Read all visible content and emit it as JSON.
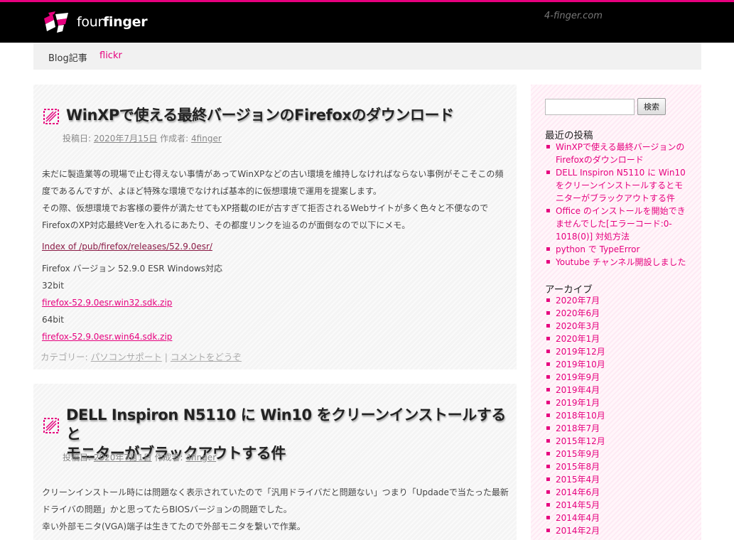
{
  "site": {
    "title_thin": "four",
    "title_bold": "finger",
    "url": "4-finger.com"
  },
  "nav": {
    "items": [
      {
        "label": "Blog記事"
      },
      {
        "label": "flickr"
      }
    ]
  },
  "posts": [
    {
      "title": "WinXPで使える最終バージョンのFirefoxのダウンロード",
      "meta_prefix": "投稿日:",
      "date": "2020年7月15日",
      "author_prefix": "作成者:",
      "author": "4finger",
      "body": [
        "未だに製造業等の現場で止む得えない事情があってWinXPなどの古い環境を維持しなければならない事例がそこそこの頻",
        "度であるんですが、よほど特殊な環境でなければ基本的に仮想環境で運用を提案します。",
        "その際、仮想環境でお客様の要件が満たせてもXP搭載のIEが古すぎて拒否されるWebサイトが多く色々と不便なので",
        "FirefoxのXP対応最終Verを入れるにあたり、その都度リンクを辿るのが面倒なので以下にメモ。"
      ],
      "link_index": "Index of /pub/firefox/releases/52.9.0esr/",
      "version_line": "Firefox バージョン 52.9.0 ESR Windows対応",
      "bit32": "32bit",
      "link32": "firefox-52.9.0esr.win32.sdk.zip",
      "bit64": "64bit",
      "link64": "firefox-52.9.0esr.win64.sdk.zip",
      "cat_prefix": "カテゴリー:",
      "category": "パソコンサポート",
      "separator": "|",
      "comment": "コメントをどうぞ"
    },
    {
      "title_line1": "DELL Inspiron N5110 に Win10 をクリーンインストールすると",
      "title_line2": "モニターがブラックアウトする件",
      "meta_prefix": "投稿日:",
      "date": "2020年7月1日",
      "author_prefix": "作成者:",
      "author": "4finger",
      "body": [
        "クリーンインストール時には問題なく表示されていたので「汎用ドライバだと問題ない」つまり「Updadeで当たった最新",
        "ドライバの問題」かと思ってたらBIOSバージョンの問題でした。",
        "幸い外部モニタ(VGA)端子は生きてたので外部モニタを繋いで作業。"
      ]
    }
  ],
  "sidebar": {
    "search_placeholder": "",
    "search_button": "検索",
    "recent_title": "最近の投稿",
    "recent": [
      {
        "label": "WinXPで使える最終バージョンのFirefoxのダウンロード"
      },
      {
        "label": "DELL Inspiron N5110 に Win10 をクリーンインストールするとモニターがブラックアウトする件"
      },
      {
        "label": "Office のインストールを開始できませんでした[エラーコード:0-1018(0)] 対処方法"
      },
      {
        "label": "python で TypeError"
      },
      {
        "label": "Youtube チャンネル開設しました"
      }
    ],
    "archive_title": "アーカイブ",
    "archives": [
      {
        "label": "2020年7月"
      },
      {
        "label": "2020年6月"
      },
      {
        "label": "2020年3月"
      },
      {
        "label": "2020年1月"
      },
      {
        "label": "2019年12月"
      },
      {
        "label": "2019年10月"
      },
      {
        "label": "2019年9月"
      },
      {
        "label": "2019年4月"
      },
      {
        "label": "2019年1月"
      },
      {
        "label": "2018年10月"
      },
      {
        "label": "2018年7月"
      },
      {
        "label": "2015年12月"
      },
      {
        "label": "2015年9月"
      },
      {
        "label": "2015年8月"
      },
      {
        "label": "2015年4月"
      },
      {
        "label": "2014年6月"
      },
      {
        "label": "2014年5月"
      },
      {
        "label": "2014年4月"
      },
      {
        "label": "2014年2月"
      }
    ]
  },
  "colors": {
    "accent": "#e6007e",
    "header_bg": "#000000",
    "nav_bg": "#f1f1f1"
  }
}
